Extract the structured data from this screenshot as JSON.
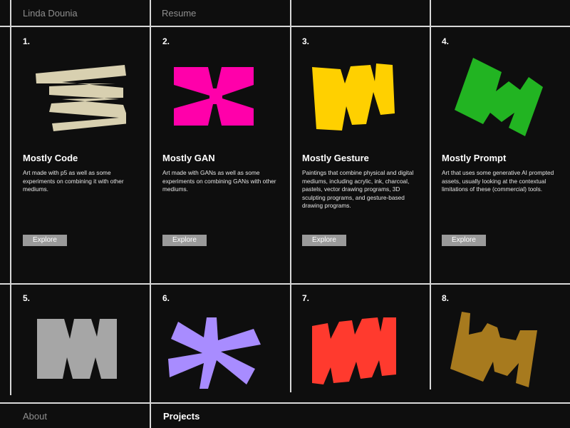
{
  "header": {
    "name": "Linda Dounia",
    "resume_label": "Resume"
  },
  "footer": {
    "about_label": "About",
    "projects_label": "Projects"
  },
  "colors": {
    "background": "#0e0e0e",
    "grid_lines": "#d8d8d8",
    "button": "#9a9a9a",
    "shape_1": "#d8d0b0",
    "shape_2": "#ff00aa",
    "shape_3": "#ffd000",
    "shape_4": "#22b422",
    "shape_5": "#a6a6a6",
    "shape_6": "#a88cff",
    "shape_7": "#ff3a2e",
    "shape_8": "#a77a1e"
  },
  "cards": [
    {
      "number": "1.",
      "title": "Mostly Code",
      "description": "Art made with p5 as well as some experiments on combining it with other mediums.",
      "button_label": "Explore"
    },
    {
      "number": "2.",
      "title": "Mostly GAN",
      "description": "Art made with GANs as well as some experiments on combining GANs with other mediums.",
      "button_label": "Explore"
    },
    {
      "number": "3.",
      "title": "Mostly Gesture",
      "description": "Paintings that combine physical and digital mediums, including acrylic, ink, charcoal, pastels, vector drawing programs, 3D sculpting programs, and gesture-based drawing programs.",
      "button_label": "Explore"
    },
    {
      "number": "4.",
      "title": "Mostly Prompt",
      "description": "Art that uses some generative AI prompted assets, usually looking at the contextual limitations of these (commercial) tools.",
      "button_label": "Explore"
    },
    {
      "number": "5."
    },
    {
      "number": "6."
    },
    {
      "number": "7."
    },
    {
      "number": "8."
    }
  ]
}
